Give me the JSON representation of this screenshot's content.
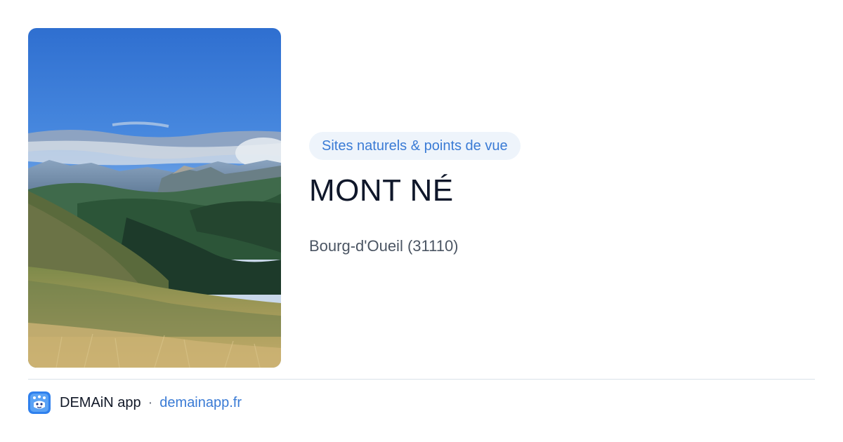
{
  "photo": {
    "icon": "mountain-landscape-photo"
  },
  "category": {
    "label": "Sites naturels & points de vue"
  },
  "place": {
    "name": "MONT NÉ",
    "location": "Bourg-d'Oueil (31110)"
  },
  "footer": {
    "app_icon": "demain-app-icon",
    "brand": "DEMAiN app",
    "separator": "·",
    "domain": "demainapp.fr"
  },
  "colors": {
    "accent": "#3a7bd5",
    "pill_background": "#eef4fb",
    "title": "#0f172a",
    "muted_text": "#4b5563",
    "divider": "#d9e1e8"
  }
}
